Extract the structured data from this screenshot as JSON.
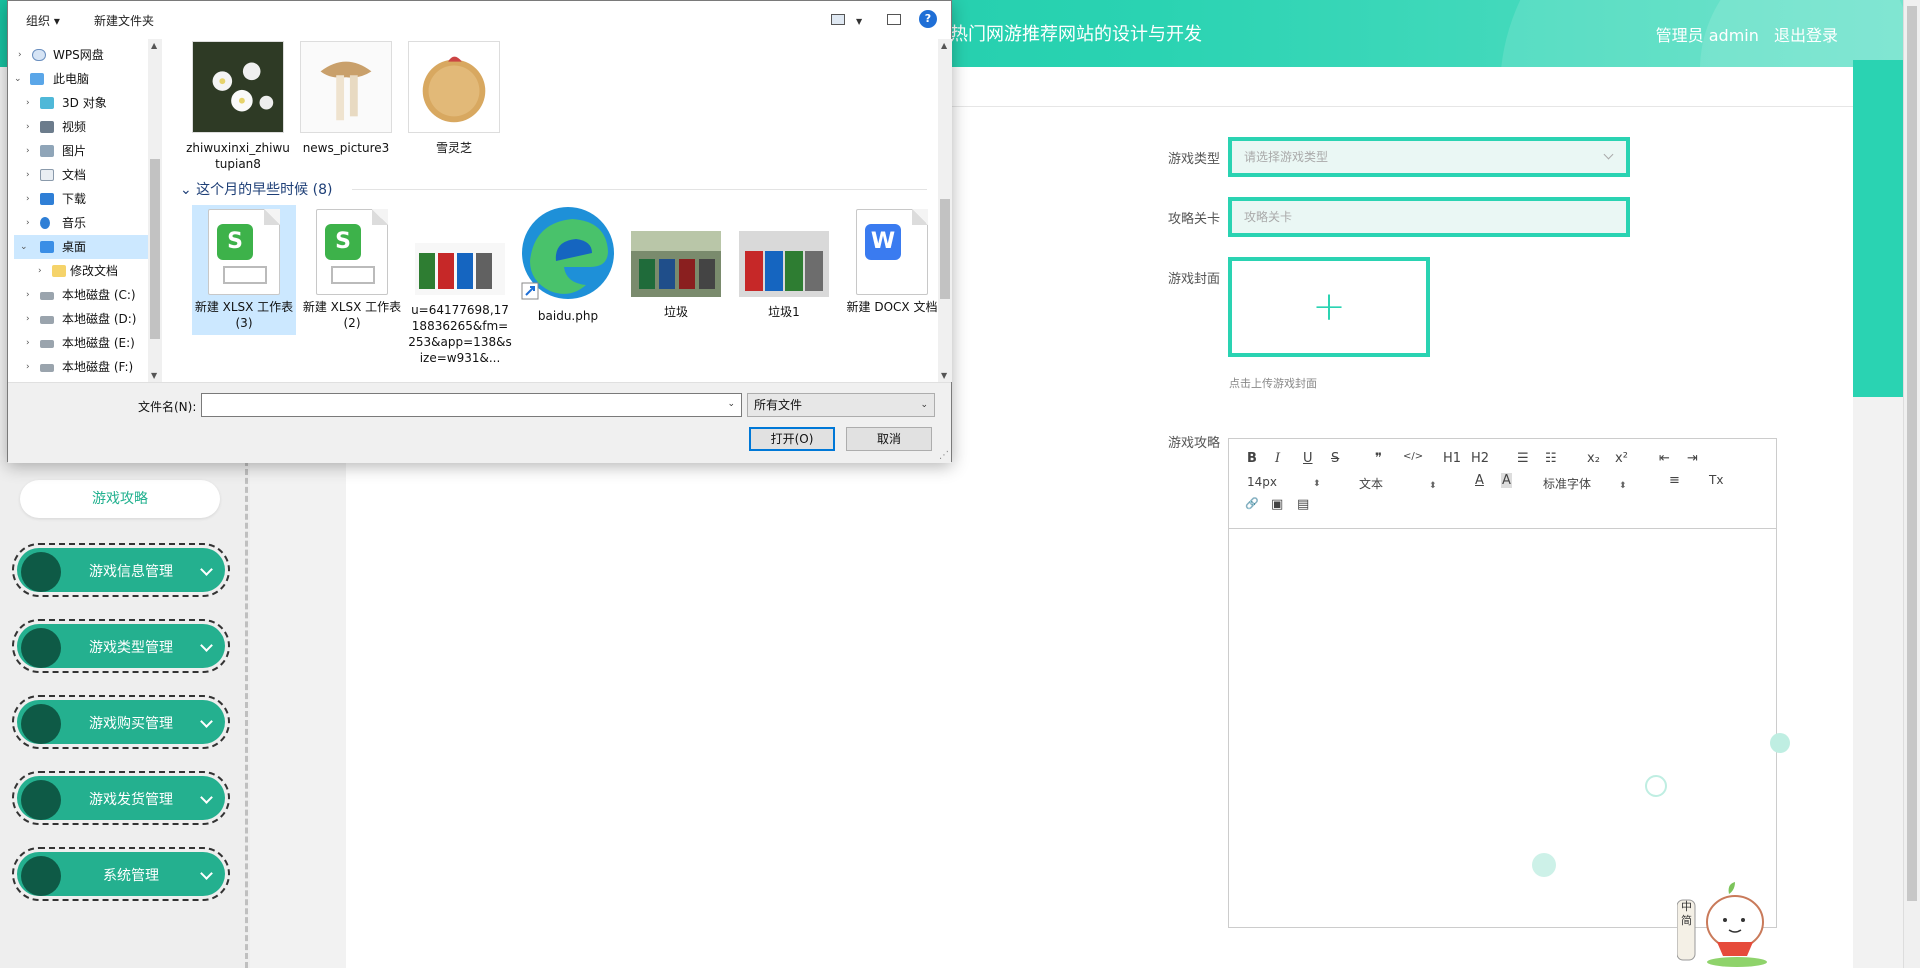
{
  "app": {
    "title": "热门网游推荐网站的设计与开发",
    "user_role": "管理员 admin",
    "logout": "退出登录",
    "sidebar": {
      "sub_item": "游戏攻略",
      "menu": [
        {
          "label": "游戏信息管理"
        },
        {
          "label": "游戏类型管理"
        },
        {
          "label": "游戏购买管理"
        },
        {
          "label": "游戏发货管理"
        },
        {
          "label": "系统管理"
        }
      ]
    },
    "form": {
      "game_type_label": "游戏类型",
      "game_type_placeholder": "请选择游戏类型",
      "level_label": "攻略关卡",
      "level_placeholder": "攻略关卡",
      "cover_label": "游戏封面",
      "upload_plus": "+",
      "upload_hint": "点击上传游戏封面",
      "guide_label": "游戏攻略"
    },
    "editor": {
      "bold": "B",
      "italic": "I",
      "underline": "U",
      "strike": "S",
      "quote": "❞",
      "code": "</>",
      "h1": "H1",
      "h2": "H2",
      "ordered_list": "☰",
      "bullet_list": "☷",
      "subscript": "x₂",
      "superscript": "x²",
      "outdent": "⇤",
      "indent": "⇥",
      "font_size": "14px",
      "text_style": "文本",
      "font_family": "标准字体",
      "font_color": "A",
      "bg_color": "A",
      "align": "≡",
      "clear_format": "Tx",
      "link": "🔗",
      "image": "▣",
      "video": "▤"
    },
    "mascot_text": "中简"
  },
  "dialog": {
    "toolbar": {
      "organize": "组织 ▾",
      "new_folder": "新建文件夹",
      "help": "?"
    },
    "nav": [
      {
        "label": "WPS网盘",
        "icon": "cloud-icon",
        "indent": 1,
        "expander": "›"
      },
      {
        "label": "此电脑",
        "icon": "computer-icon",
        "indent": 0,
        "expander": "⌄"
      },
      {
        "label": "3D 对象",
        "icon": "3d-objects-icon",
        "indent": 1,
        "expander": "›"
      },
      {
        "label": "视频",
        "icon": "video-folder-icon",
        "indent": 1,
        "expander": "›"
      },
      {
        "label": "图片",
        "icon": "pictures-folder-icon",
        "indent": 1,
        "expander": "›"
      },
      {
        "label": "文档",
        "icon": "documents-folder-icon",
        "indent": 1,
        "expander": "›"
      },
      {
        "label": "下载",
        "icon": "downloads-folder-icon",
        "indent": 1,
        "expander": "›"
      },
      {
        "label": "音乐",
        "icon": "music-folder-icon",
        "indent": 1,
        "expander": "›"
      },
      {
        "label": "桌面",
        "icon": "desktop-folder-icon",
        "indent": 1,
        "expander": "⌄",
        "selected": true
      },
      {
        "label": "修改文档",
        "icon": "folder-icon",
        "indent": 2,
        "expander": "›"
      },
      {
        "label": "本地磁盘 (C:)",
        "icon": "drive-icon",
        "indent": 1,
        "expander": "›"
      },
      {
        "label": "本地磁盘 (D:)",
        "icon": "drive-icon",
        "indent": 1,
        "expander": "›"
      },
      {
        "label": "本地磁盘 (E:)",
        "icon": "drive-icon",
        "indent": 1,
        "expander": "›"
      },
      {
        "label": "本地磁盘 (F:)",
        "icon": "drive-icon",
        "indent": 1,
        "expander": "›"
      }
    ],
    "top_files": [
      {
        "name": "zhiwuxinxi_zhiwutupian8"
      },
      {
        "name": "news_picture3"
      },
      {
        "name": "雪灵芝"
      }
    ],
    "group_header": "⌄ 这个月的早些时候 (8)",
    "files": [
      {
        "name": "新建 XLSX 工作表 (3)",
        "badge": "S",
        "selected": true
      },
      {
        "name": "新建 XLSX 工作表 (2)",
        "badge": "S"
      },
      {
        "name": "u=64177698,1718836265&fm=253&app=138&size=w931&..."
      },
      {
        "name": "baidu.php"
      },
      {
        "name": "垃圾"
      },
      {
        "name": "垃圾1"
      },
      {
        "name": "新建 DOCX 文档",
        "badge": "W"
      }
    ],
    "filename_label": "文件名(N):",
    "filename_value": "",
    "filetype": "所有文件",
    "open_button": "打开(O)",
    "cancel_button": "取消",
    "colors": {
      "accent": "#2ad3b2",
      "selection": "#cce8ff",
      "wps_green": "#3db24a",
      "wps_blue": "#3a7bf0"
    }
  }
}
